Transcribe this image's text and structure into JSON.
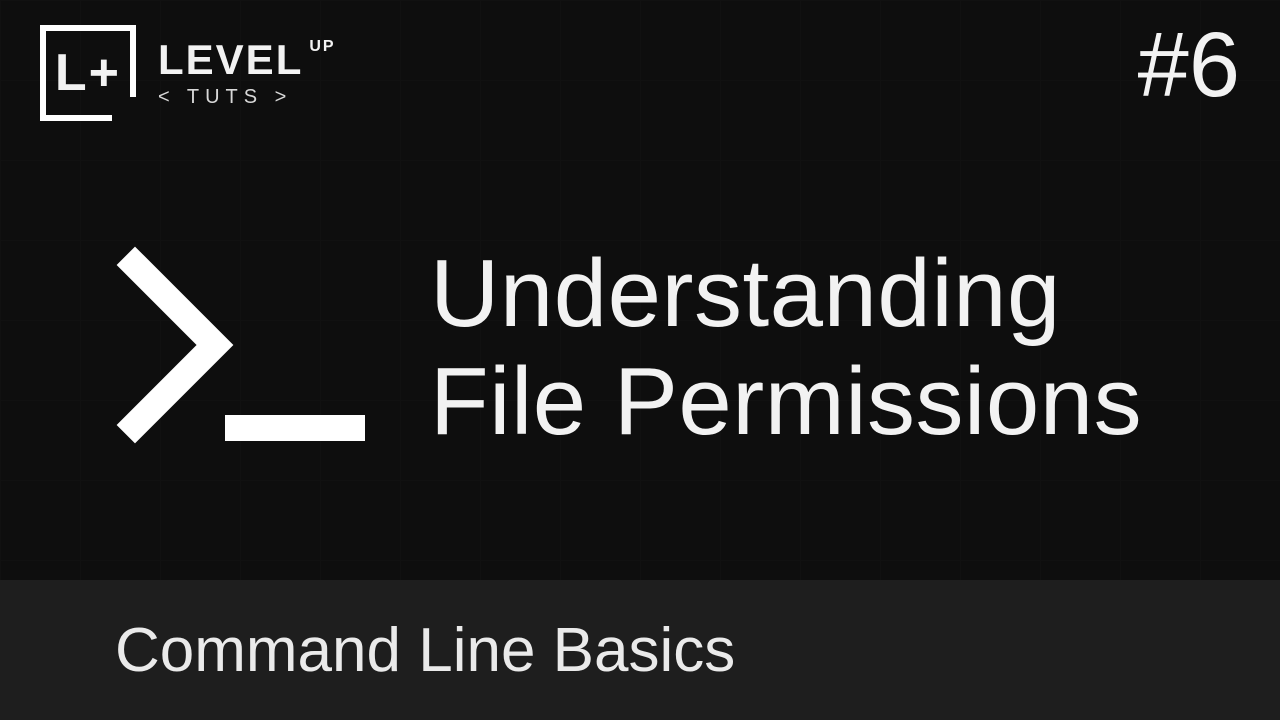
{
  "logo": {
    "box_text": "L+",
    "brand_main": "LEVEL",
    "brand_up": "UP",
    "brand_tuts": "< TUTS >"
  },
  "episode_number": "#6",
  "title_line1": "Understanding",
  "title_line2": "File Permissions",
  "subtitle": "Command Line Basics"
}
